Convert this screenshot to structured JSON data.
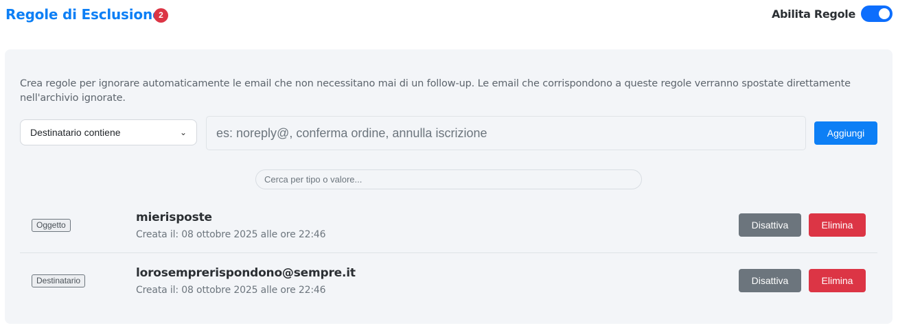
{
  "header": {
    "title": "Regole di Esclusione",
    "rules_count": "2",
    "toggle_label": "Abilita Regole",
    "toggle_on": true
  },
  "panel": {
    "description": "Crea regole per ignorare automaticamente le email che non necessitano mai di un follow-up. Le email che corrispondono a queste regole verranno spostate direttamente nell'archivio ignorate.",
    "type_select": {
      "selected": "Destinatario contiene",
      "icon": "chevron-down-icon"
    },
    "value_input": {
      "value": "",
      "placeholder": "es: noreply@, conferma ordine, annulla iscrizione"
    },
    "add_label": "Aggiungi",
    "search": {
      "value": "",
      "placeholder": "Cerca per tipo o valore..."
    }
  },
  "rules": [
    {
      "type": "Oggetto",
      "value": "mierisposte",
      "created": "Creata il: 08 ottobre 2025 alle ore 22:46",
      "deactivate_label": "Disattiva",
      "delete_label": "Elimina"
    },
    {
      "type": "Destinatario",
      "value": "lorosemprerispondono@sempre.it",
      "created": "Creata il: 08 ottobre 2025 alle ore 22:46",
      "deactivate_label": "Disattiva",
      "delete_label": "Elimina"
    }
  ],
  "colors": {
    "accent": "#0d7ff5",
    "badge": "#dc3545",
    "secondary": "#6c757d",
    "danger": "#dc3545",
    "panel": "#f3f5f8"
  }
}
